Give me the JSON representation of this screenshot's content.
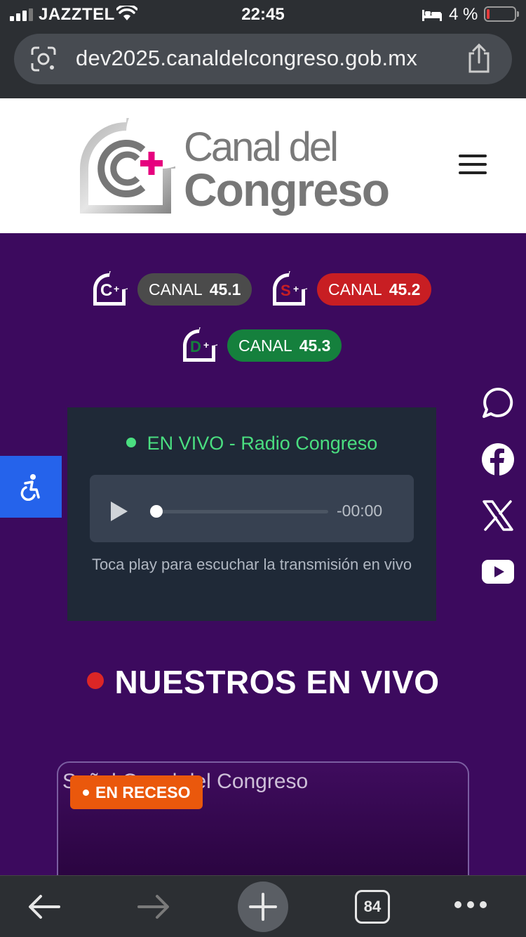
{
  "status_bar": {
    "carrier": "JAZZTEL",
    "time": "22:45",
    "battery_percent": "4 %"
  },
  "browser": {
    "url": "dev2025.canaldelcongreso.gob.mx",
    "tab_count": "84"
  },
  "header": {
    "logo_line1": "Canal del",
    "logo_line2": "Congreso"
  },
  "channels": [
    {
      "prefix": "CANAL",
      "number": "45.1",
      "color": "#4b4b4b",
      "logo_letter": "C"
    },
    {
      "prefix": "CANAL",
      "number": "45.2",
      "color": "#c81e23",
      "logo_letter": "S"
    },
    {
      "prefix": "CANAL",
      "number": "45.3",
      "color": "#15803d",
      "logo_letter": "D"
    }
  ],
  "radio": {
    "live_label": "EN VIVO - Radio Congreso",
    "time_display": "-00:00",
    "progress": 0,
    "hint": "Toca play para escuchar la transmisión en vivo"
  },
  "headline": "NUESTROS EN VIVO",
  "stream": {
    "title": "Señal Canal del Congreso",
    "badge": "EN RECESO"
  },
  "social": [
    "whatsapp-icon",
    "facebook-icon",
    "x-icon",
    "youtube-icon"
  ],
  "colors": {
    "page_bg": "#3c0a5e",
    "accent_pink": "#e6007e",
    "live_green": "#4ade80",
    "a11y_blue": "#2563eb",
    "recess_orange": "#ea580c"
  }
}
